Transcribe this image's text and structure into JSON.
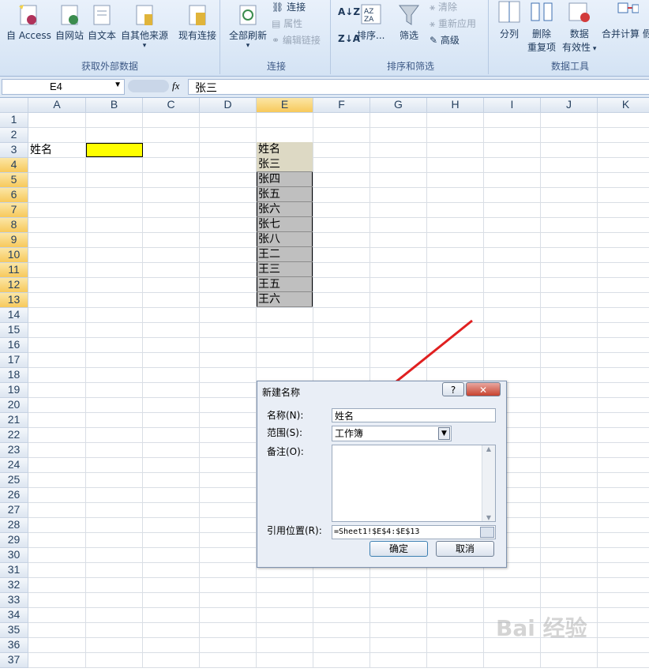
{
  "ribbon": {
    "groups": [
      {
        "label": "获取外部数据",
        "buttons": [
          "自 Access",
          "自网站",
          "自文本",
          "自其他来源",
          "现有连接"
        ]
      },
      {
        "label": "连接",
        "buttons": [
          "全部刷新"
        ],
        "small": [
          "连接",
          "属性",
          "编辑链接"
        ]
      },
      {
        "label": "排序和筛选",
        "buttons": [
          "排序...",
          "筛选"
        ],
        "small": [
          "清除",
          "重新应用",
          "高级"
        ]
      },
      {
        "label": "数据工具",
        "buttons": [
          "分列",
          "删除",
          "重复项",
          "数据",
          "有效性",
          "合并计算",
          "假"
        ]
      }
    ]
  },
  "formula_bar": {
    "cell_ref": "E4",
    "fx": "fx",
    "content": "张三"
  },
  "sheet": {
    "columns": [
      "A",
      "B",
      "C",
      "D",
      "E",
      "F",
      "G",
      "H",
      "I",
      "J",
      "K"
    ],
    "rows": [
      "1",
      "2",
      "3",
      "4",
      "5",
      "6",
      "7",
      "8",
      "9",
      "10",
      "11",
      "12",
      "13",
      "14",
      "15",
      "16",
      "17",
      "18",
      "19",
      "20",
      "21",
      "22",
      "23",
      "24",
      "25",
      "26",
      "27",
      "28",
      "29",
      "30",
      "31",
      "32",
      "33",
      "34",
      "35",
      "36",
      "37"
    ],
    "a3": "姓名",
    "e3": "姓名",
    "names": [
      "张三",
      "张四",
      "张五",
      "张六",
      "张七",
      "张八",
      "王二",
      "王三",
      "王五",
      "王六"
    ],
    "b3_fill": "#ffff00"
  },
  "dialog": {
    "title": "新建名称",
    "help": "?",
    "close": "✕",
    "name_label": "名称(N):",
    "name_value": "姓名",
    "scope_label": "范围(S):",
    "scope_value": "工作簿",
    "comment_label": "备注(O):",
    "refers_label": "引用位置(R):",
    "refers_value": "=Sheet1!$E$4:$E$13",
    "ok": "确定",
    "cancel": "取消"
  },
  "watermark": "Bai 经验"
}
